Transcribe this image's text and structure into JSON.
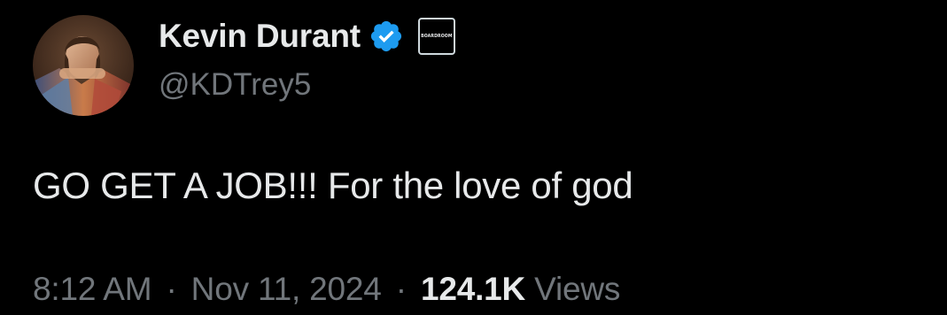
{
  "author": {
    "display_name": "Kevin Durant",
    "handle": "@KDTrey5",
    "verified": true,
    "verified_color": "#1d9bf0",
    "affiliate_badge_text": "BOARDROOM"
  },
  "tweet": {
    "text": "GO GET A JOB!!! For the love of god",
    "time": "8:12 AM",
    "separator": "·",
    "date": "Nov 11, 2024",
    "views_count": "124.1K",
    "views_label": "Views"
  },
  "colors": {
    "background": "#000000",
    "primary_text": "#e7e9ea",
    "secondary_text": "#71767b"
  },
  "icons": {
    "verified": "verified-badge-icon",
    "avatar": "profile-avatar"
  }
}
